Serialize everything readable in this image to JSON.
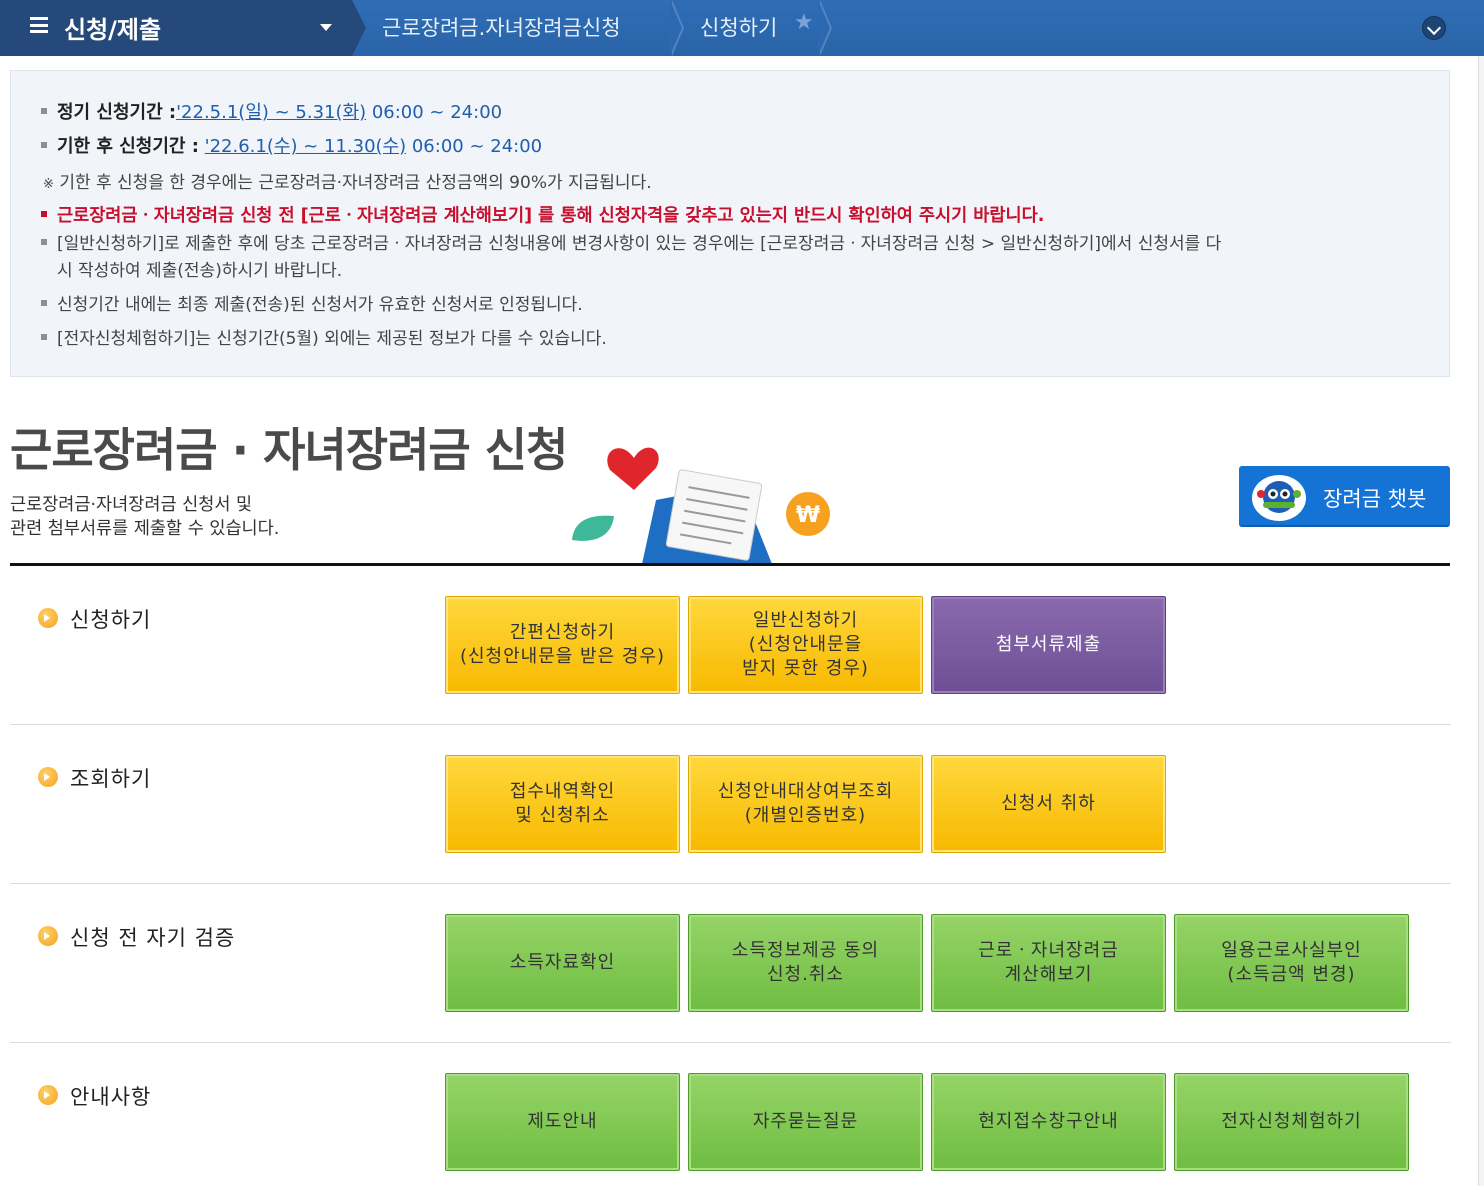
{
  "nav": {
    "menu_title": "신청/제출",
    "crumbs": [
      "근로장려금.자녀장려금신청",
      "신청하기"
    ]
  },
  "notice": {
    "regular_label": "정기 신청기간 :",
    "regular_dates": "'22.5.1(일) ~ 5.31(화)",
    "regular_time": " 06:00 ~ 24:00",
    "late_label": "기한 후 신청기간 :",
    "late_dates": "'22.6.1(수) ~ 11.30(수)",
    "late_time": " 06:00 ~ 24:00",
    "note_mark": "※",
    "note": "기한 후 신청을 한 경우에는 근로장려금·자녀장려금 산정금액의 90%가 지급됩니다.",
    "warning": "근로장려금ㆍ자녀장려금 신청 전 [근로ㆍ자녀장려금 계산해보기] 를 통해 신청자격을 갖추고 있는지 반드시 확인하여 주시기 바랍니다.",
    "general_line1": "[일반신청하기]로 제출한 후에 당초 근로장려금ㆍ자녀장려금 신청내용에 변경사항이 있는 경우에는  [근로장려금ㆍ자녀장려금 신청 > 일반신청하기]에서  신청서를 다",
    "general_line2": "시 작성하여 제출(전송)하시기 바랍니다.",
    "final_submission": "신청기간 내에는 최종 제출(전송)된 신청서가 유효한 신청서로 인정됩니다.",
    "experience": "[전자신청체험하기]는 신청기간(5월) 외에는 제공된 정보가 다를 수 있습니다."
  },
  "heading": {
    "title": "근로장려금 · 자녀장려금 신청",
    "desc_line1": "근로장려금·자녀장려금 신청서 및",
    "desc_line2": "관련 첨부서류를 제출할 수 있습니다.",
    "chatbot_label": "장려금 챗봇"
  },
  "sections": {
    "apply": {
      "label": "신청하기",
      "buttons": [
        "간편신청하기\n(신청안내문을 받은 경우)",
        "일반신청하기\n(신청안내문을\n받지 못한 경우)",
        "첨부서류제출"
      ]
    },
    "inquiry": {
      "label": "조회하기",
      "buttons": [
        "접수내역확인\n및 신청취소",
        "신청안내대상여부조회\n(개별인증번호)",
        "신청서 취하"
      ]
    },
    "verify": {
      "label": "신청 전 자기 검증",
      "buttons": [
        "소득자료확인",
        "소득정보제공 동의\n신청.취소",
        "근로ㆍ자녀장려금\n계산해보기",
        "일용근로사실부인\n(소득금액 변경)"
      ]
    },
    "guide": {
      "label": "안내사항",
      "buttons": [
        "제도안내",
        "자주묻는질문",
        "현지접수창구안내",
        "전자신청체험하기"
      ]
    }
  },
  "colors": {
    "nav_dark": "#25497a",
    "nav_blue": "#2f6db5",
    "warning_red": "#c8102e",
    "link_blue": "#1f5fae",
    "btn_yellow": "#f7b900",
    "btn_purple": "#6e4f96",
    "btn_green": "#6fbd42",
    "chatbot_blue": "#1673d6"
  }
}
